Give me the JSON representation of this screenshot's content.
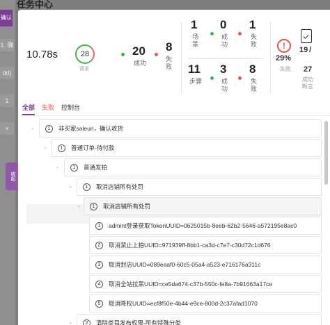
{
  "background": {
    "side_tab_1": "确认收",
    "side_pill": "收起"
  },
  "drawer": {
    "title": "任务中心"
  },
  "stats": {
    "duration": "10.78s",
    "requests": {
      "value": "28",
      "label": "请求"
    },
    "success": {
      "value": "20",
      "label": "成功"
    },
    "fail": {
      "value": "8",
      "label": "失败"
    },
    "scene": {
      "value": "1",
      "label": "场景",
      "success_value": "0",
      "success_label": "成功",
      "fail_value": "1",
      "fail_label": "失败"
    },
    "step": {
      "value": "11",
      "label": "步骤",
      "success_value": "3",
      "success_label": "成功",
      "fail_value": "8",
      "fail_label": "失败"
    },
    "fail_rate": {
      "value": "29%",
      "label": "失败"
    },
    "assert": {
      "passed": "19",
      "total": "27",
      "label": "成功断言"
    },
    "colors": {
      "success": "#3bb54a",
      "fail": "#e2574c",
      "accent": "#7a3f95"
    }
  },
  "tabs": [
    {
      "label": "全部",
      "active": true
    },
    {
      "label": "失败",
      "active": false
    },
    {
      "label": "控制台",
      "active": false
    }
  ],
  "tree": [
    {
      "num": "1",
      "label": "非买家saleuri，确认收货"
    },
    {
      "num": "1",
      "label": "普通订单-待付款"
    },
    {
      "num": "1",
      "label": "普通发拍"
    },
    {
      "num": "1",
      "label": "取消店铺所有处罚"
    },
    {
      "num": "1",
      "label": "取消店铺所有处罚"
    },
    {
      "num": "1",
      "label": "admint登录获取TokenUUID=0625015b-8eeb-62b2-5646-a572195e8ac0"
    },
    {
      "num": "2",
      "label": "取消禁止上拍UUID=971939ff-8bb1-ca3d-c7e7-c30d72c1d676"
    },
    {
      "num": "3",
      "label": "取消封店UUID=089eaaf0-60c5-05a4-a523-e716176a311c"
    },
    {
      "num": "4",
      "label": "取消全站拉黑UUID=ce5da674-c37b-550c-fe8a-7b91663a17ce"
    },
    {
      "num": "5",
      "label": "取消降权UUID=ecf8f50e-4b44-e9ce-800d-2c37afad1070"
    },
    {
      "num": "2",
      "label": "清除类目发布权限-所有特殊分类"
    }
  ]
}
